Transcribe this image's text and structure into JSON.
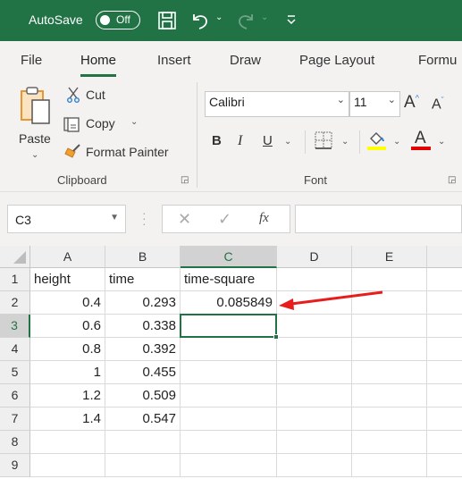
{
  "titlebar": {
    "autosave_label": "AutoSave",
    "autosave_state": "Off",
    "icons": [
      "save-icon",
      "undo-icon",
      "redo-icon",
      "customize-toolbar-icon"
    ]
  },
  "ribbon_tabs": [
    {
      "label": "File",
      "active": false
    },
    {
      "label": "Home",
      "active": true
    },
    {
      "label": "Insert",
      "active": false
    },
    {
      "label": "Draw",
      "active": false
    },
    {
      "label": "Page Layout",
      "active": false
    },
    {
      "label": "Formu",
      "active": false
    }
  ],
  "clipboard": {
    "group_label": "Clipboard",
    "paste_label": "Paste",
    "cut_label": "Cut",
    "copy_label": "Copy",
    "format_painter_label": "Format Painter"
  },
  "font": {
    "group_label": "Font",
    "font_name": "Calibri",
    "font_size": "11",
    "bold": "B",
    "italic": "I",
    "underline": "U",
    "highlight_color": "#ffff00",
    "font_color": "#e00000"
  },
  "formula_bar": {
    "name_box": "C3",
    "fx_label": "fx",
    "formula": ""
  },
  "sheet": {
    "columns": [
      "A",
      "B",
      "C",
      "D",
      "E"
    ],
    "selected_column": "C",
    "rows": [
      "1",
      "2",
      "3",
      "4",
      "5",
      "6",
      "7",
      "8",
      "9"
    ],
    "selected_row": "3",
    "selected_cell": "C3",
    "cells": [
      [
        "height",
        "time",
        "time-square",
        "",
        ""
      ],
      [
        "0.4",
        "0.293",
        "0.085849",
        "",
        ""
      ],
      [
        "0.6",
        "0.338",
        "",
        "",
        ""
      ],
      [
        "0.8",
        "0.392",
        "",
        "",
        ""
      ],
      [
        "1",
        "0.455",
        "",
        "",
        ""
      ],
      [
        "1.2",
        "0.509",
        "",
        "",
        ""
      ],
      [
        "1.4",
        "0.547",
        "",
        "",
        ""
      ],
      [
        "",
        "",
        "",
        "",
        ""
      ],
      [
        "",
        "",
        "",
        "",
        ""
      ]
    ]
  },
  "annotation": {
    "arrow_color": "#e81c1c",
    "points_to": "C2"
  },
  "colors": {
    "accent": "#217346"
  }
}
